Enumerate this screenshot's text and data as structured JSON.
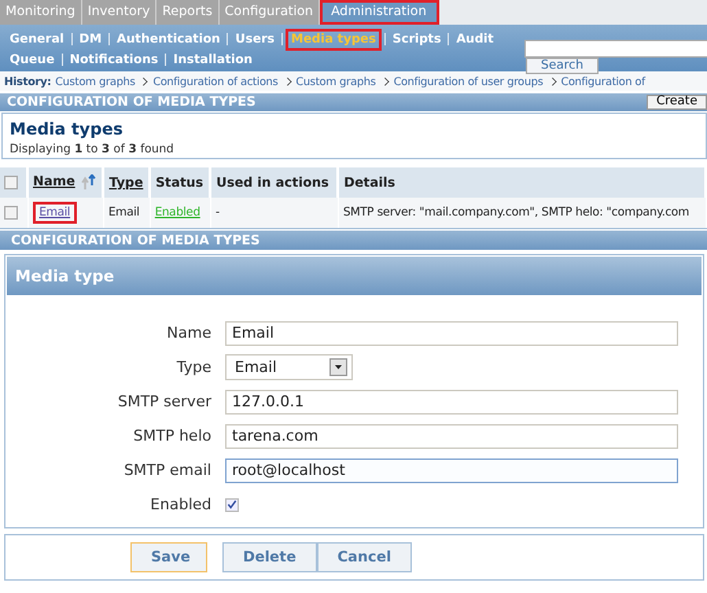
{
  "main_menu": [
    {
      "label": "Monitoring",
      "selected": false,
      "highlighted": false
    },
    {
      "label": "Inventory",
      "selected": false,
      "highlighted": false
    },
    {
      "label": "Reports",
      "selected": false,
      "highlighted": false
    },
    {
      "label": "Configuration",
      "selected": false,
      "highlighted": false
    },
    {
      "label": "Administration",
      "selected": true,
      "highlighted": true
    }
  ],
  "sub_menu": [
    [
      {
        "label": "General",
        "selected": false,
        "highlighted": false
      },
      {
        "label": "DM",
        "selected": false,
        "highlighted": false
      },
      {
        "label": "Authentication",
        "selected": false,
        "highlighted": false
      },
      {
        "label": "Users",
        "selected": false,
        "highlighted": false
      },
      {
        "label": "Media types",
        "selected": true,
        "highlighted": true
      },
      {
        "label": "Scripts",
        "selected": false,
        "highlighted": false
      },
      {
        "label": "Audit",
        "selected": false,
        "highlighted": false
      }
    ],
    [
      {
        "label": "Queue",
        "selected": false,
        "highlighted": false
      },
      {
        "label": "Notifications",
        "selected": false,
        "highlighted": false
      },
      {
        "label": "Installation",
        "selected": false,
        "highlighted": false
      }
    ]
  ],
  "search": {
    "button": "Search"
  },
  "history": {
    "label": "History:",
    "items": [
      "Custom graphs",
      "Configuration of actions",
      "Custom graphs",
      "Configuration of user groups",
      "Configuration of"
    ]
  },
  "list_header": {
    "title": "CONFIGURATION OF MEDIA TYPES",
    "button": "Create"
  },
  "list": {
    "title": "Media types",
    "all_checked": false,
    "summary": "Displaying **1** to **3** of **3** found",
    "columns": [
      {
        "label": "Name",
        "link": true,
        "sorted": true
      },
      {
        "label": "Type",
        "link": true,
        "sorted": false
      },
      {
        "label": "Status",
        "link": false,
        "sorted": false
      },
      {
        "label": "Used in actions",
        "link": false,
        "sorted": false
      },
      {
        "label": "Details",
        "link": false,
        "sorted": false
      }
    ],
    "rows": [
      {
        "checked": false,
        "name": "Email",
        "name_highlighted": true,
        "type": "Email",
        "status": "Enabled",
        "used_in_actions": "-",
        "details": "SMTP server: \"mail.company.com\", SMTP helo: \"company.com"
      }
    ]
  },
  "form_header": {
    "title": "CONFIGURATION OF MEDIA TYPES"
  },
  "form": {
    "title": "Media type",
    "fields": [
      {
        "kind": "text",
        "label": "Name",
        "value": "Email",
        "focused": false
      },
      {
        "kind": "select",
        "label": "Type",
        "value": "Email"
      },
      {
        "kind": "text",
        "label": "SMTP server",
        "value": "127.0.0.1",
        "focused": false
      },
      {
        "kind": "text",
        "label": "SMTP helo",
        "value": "tarena.com",
        "focused": false
      },
      {
        "kind": "text",
        "label": "SMTP email",
        "value": "root@localhost",
        "focused": true
      },
      {
        "kind": "checkbox",
        "label": "Enabled",
        "checked": true
      }
    ],
    "buttons": [
      {
        "label": "Save",
        "primary": true
      },
      {
        "label": "Delete",
        "primary": false
      },
      {
        "label": "Cancel",
        "primary": false
      }
    ]
  }
}
